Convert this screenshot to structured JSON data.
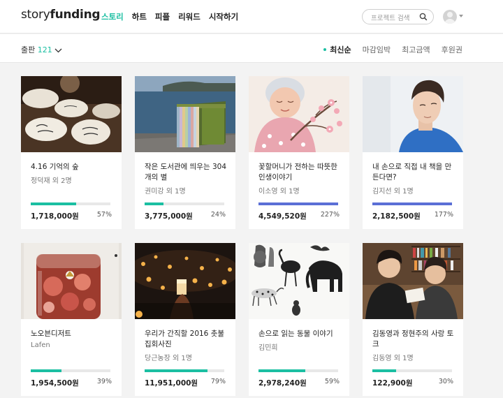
{
  "header": {
    "logo_light": "story",
    "logo_bold": "funding",
    "nav": [
      "스토리",
      "하트",
      "피플",
      "리워드",
      "시작하기"
    ],
    "search_placeholder": "프로젝트 검색"
  },
  "filter": {
    "category": "출판",
    "count": "121",
    "sorts": [
      "최신순",
      "마감임박",
      "최고금액",
      "후원권"
    ],
    "active_sort": "최신순"
  },
  "colors": {
    "accent": "#1bbfa2",
    "over_goal": "#5b6fd6"
  },
  "cards": [
    {
      "title": "4.16 기억의 숲",
      "author": "정덕재 외 2명",
      "amount": "1,718,000원",
      "percent": "57%",
      "progress": 0.57,
      "image": "engraved-wooden-tokens"
    },
    {
      "title": "작은 도서관에 띄우는 304개의 별",
      "author": "권미강 외 1명",
      "amount": "3,775,000원",
      "percent": "24%",
      "progress": 0.24,
      "image": "book-box-set-by-sea"
    },
    {
      "title": "꽃할머니가 전하는 따뜻한 인생이야기",
      "author": "이소영 외 1명",
      "amount": "4,549,520원",
      "percent": "227%",
      "progress": 1.0,
      "image": "grandmother-with-flowers-illustration"
    },
    {
      "title": "내 손으로 직접 내 책을 만든다면?",
      "author": "김지선 외 1명",
      "amount": "2,182,500원",
      "percent": "177%",
      "progress": 1.0,
      "image": "young-man-portrait"
    },
    {
      "title": "노오븐디저트",
      "author": "Lafen",
      "amount": "1,954,500원",
      "percent": "39%",
      "progress": 0.39,
      "image": "fruit-jelly-dessert-jar"
    },
    {
      "title": "우리가 간직할 2016 촛불집회사진",
      "author": "당근농장 외 1명",
      "amount": "11,951,000원",
      "percent": "79%",
      "progress": 0.79,
      "image": "candlelight-crowd"
    },
    {
      "title": "손으로 읽는 동물 이야기",
      "author": "김민희",
      "amount": "2,978,240원",
      "percent": "59%",
      "progress": 0.59,
      "image": "animal-illustrations"
    },
    {
      "title": "김동영과 정현주의 사랑 토크",
      "author": "김동영 외 1명",
      "amount": "122,900원",
      "percent": "30%",
      "progress": 0.3,
      "image": "two-people-in-bookstore"
    }
  ]
}
